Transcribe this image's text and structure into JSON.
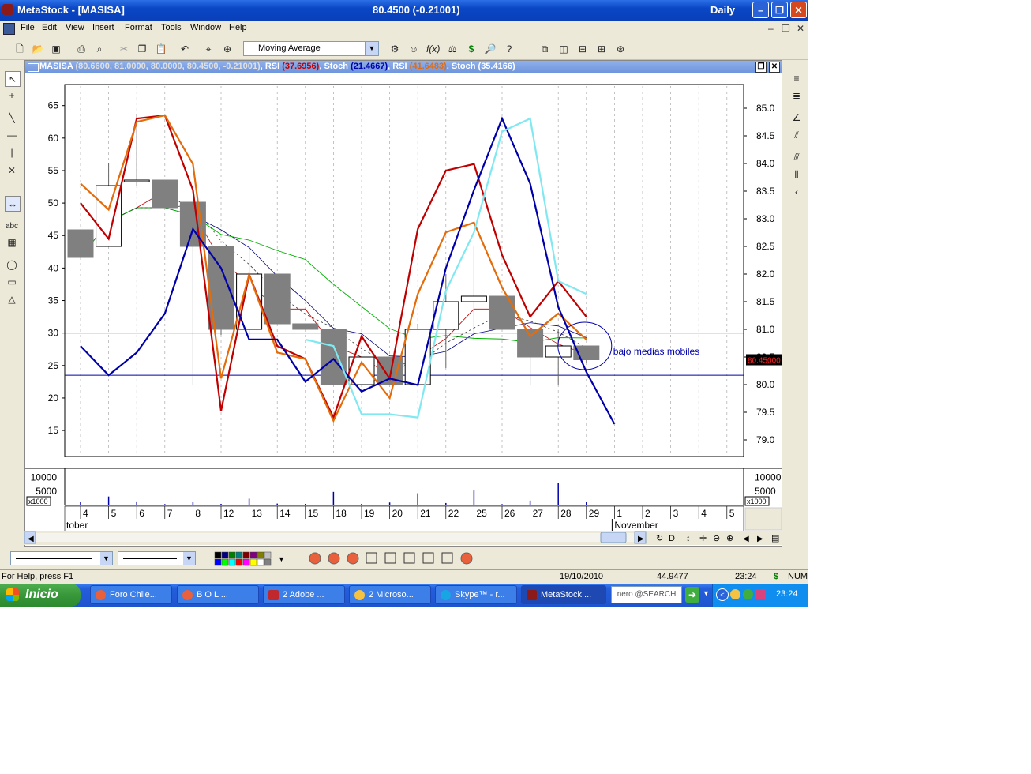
{
  "window": {
    "app_title": "MetaStock - [MASISA]",
    "quote": "80.4500 (-0.21001)",
    "period": "Daily"
  },
  "menu": [
    "File",
    "Edit",
    "View",
    "Insert",
    "Format",
    "Tools",
    "Window",
    "Help"
  ],
  "toolbar": {
    "indicator_select": "Moving Average"
  },
  "chart": {
    "title": {
      "name": "MASISA",
      "ohlc": "(80.6600, 81.0000, 80.0000, 80.4500, -0.21001)",
      "ind1": "RSI",
      "ind1_val": "(37.6956)",
      "ind2": "Stoch",
      "ind2_val": "(21.4667)",
      "ind3": "RSI",
      "ind3_val": "(41.6483)",
      "ind4": "Stoch",
      "ind4_val": "(35.4166)",
      "sep": ","
    },
    "left_axis": [
      "65",
      "60",
      "55",
      "50",
      "45",
      "40",
      "35",
      "30",
      "25",
      "20",
      "15"
    ],
    "right_axis": [
      "85.0",
      "84.5",
      "84.0",
      "83.5",
      "83.0",
      "82.5",
      "82.0",
      "81.5",
      "81.0",
      "80.5",
      "80.0",
      "79.5",
      "79.0"
    ],
    "price_label": "80.45000",
    "annotation": "bajo medias mobiles",
    "volume_axis": [
      "10000",
      "5000"
    ],
    "volume_unit": "x1000",
    "dates": [
      "4",
      "5",
      "6",
      "7",
      "8",
      "12",
      "13",
      "14",
      "15",
      "18",
      "19",
      "20",
      "21",
      "22",
      "25",
      "26",
      "27",
      "28",
      "29",
      "1",
      "2",
      "3",
      "4",
      "5"
    ],
    "month_left": "tober",
    "month_right": "November",
    "chart_data": {
      "type": "candlestick",
      "x": [
        "4",
        "5",
        "6",
        "7",
        "8",
        "12",
        "13",
        "14",
        "15",
        "18",
        "19",
        "20",
        "21",
        "22",
        "25",
        "26",
        "27",
        "28",
        "29"
      ],
      "price_axis_range": [
        78.7,
        85.4
      ],
      "oscillator_axis_range": [
        11,
        68
      ],
      "candles": [
        {
          "o": 82.8,
          "h": 82.8,
          "l": 82.3,
          "c": 82.3,
          "down": true
        },
        {
          "o": 82.5,
          "h": 84.0,
          "l": 82.5,
          "c": 83.6,
          "down": false
        },
        {
          "o": 83.7,
          "h": 84.9,
          "l": 83.6,
          "c": 83.7,
          "down": false
        },
        {
          "o": 83.7,
          "h": 83.7,
          "l": 83.2,
          "c": 83.2,
          "down": true
        },
        {
          "o": 83.3,
          "h": 83.3,
          "l": 80.0,
          "c": 82.5,
          "down": true
        },
        {
          "o": 82.5,
          "h": 82.5,
          "l": 80.9,
          "c": 81.0,
          "down": true
        },
        {
          "o": 81.0,
          "h": 82.5,
          "l": 80.9,
          "c": 82.0,
          "down": false
        },
        {
          "o": 82.0,
          "h": 82.0,
          "l": 81.1,
          "c": 81.1,
          "down": true
        },
        {
          "o": 81.1,
          "h": 81.1,
          "l": 81.0,
          "c": 81.0,
          "down": true
        },
        {
          "o": 81.0,
          "h": 81.0,
          "l": 80.0,
          "c": 80.0,
          "down": true
        },
        {
          "o": 80.0,
          "h": 80.5,
          "l": 80.0,
          "c": 80.5,
          "down": false
        },
        {
          "o": 80.5,
          "h": 80.5,
          "l": 80.0,
          "c": 80.0,
          "down": true
        },
        {
          "o": 80.0,
          "h": 81.1,
          "l": 80.0,
          "c": 81.0,
          "down": false
        },
        {
          "o": 81.0,
          "h": 82.0,
          "l": 80.3,
          "c": 81.5,
          "down": false
        },
        {
          "o": 81.5,
          "h": 82.5,
          "l": 80.8,
          "c": 81.6,
          "down": false
        },
        {
          "o": 81.6,
          "h": 81.6,
          "l": 81.0,
          "c": 81.0,
          "down": true
        },
        {
          "o": 81.0,
          "h": 81.0,
          "l": 80.0,
          "c": 80.5,
          "down": true
        },
        {
          "o": 80.5,
          "h": 81.0,
          "l": 80.0,
          "c": 80.7,
          "down": false
        },
        {
          "o": 80.7,
          "h": 80.7,
          "l": 80.4,
          "c": 80.45,
          "down": true
        }
      ],
      "horizontal_lines_osc": [
        70,
        30,
        23.5
      ],
      "series": [
        {
          "name": "RSI",
          "color": "#c00000",
          "values": [
            50,
            44.5,
            63,
            63.5,
            52,
            18,
            39,
            28,
            26,
            17,
            29.5,
            23,
            46,
            55,
            56,
            42,
            32.5,
            38,
            32.5
          ]
        },
        {
          "name": "RSI",
          "color": "#e46c0a",
          "values": [
            53,
            49,
            62.5,
            63.5,
            56,
            23,
            39,
            27,
            26,
            16.5,
            25.5,
            20,
            36,
            45.5,
            47,
            37,
            29.5,
            33,
            29
          ]
        },
        {
          "name": "Stoch",
          "color": "#0000aa",
          "values": [
            28,
            23.5,
            27,
            33,
            46,
            40,
            29,
            29,
            22.5,
            26,
            21,
            23,
            22,
            40,
            52,
            63,
            53,
            34,
            24,
            16
          ]
        },
        {
          "name": "Stoch",
          "color": "#80e8f0",
          "values": [
            null,
            null,
            null,
            null,
            null,
            null,
            34,
            null,
            29,
            28,
            17.5,
            17.5,
            17,
            36.5,
            45.5,
            61,
            63,
            38,
            36
          ]
        }
      ],
      "volume": [
        1000,
        3000,
        1200,
        200,
        900,
        300,
        2200,
        400,
        300,
        4700,
        300,
        800,
        4200,
        600,
        5200,
        200,
        1500,
        8000,
        1000
      ]
    }
  },
  "bottom": {
    "color_swatches": [
      "#000000",
      "#000080",
      "#008000",
      "#008080",
      "#800000",
      "#800080",
      "#808000",
      "#c0c0c0",
      "#0000ff",
      "#00ff00",
      "#00ffff",
      "#ff0000",
      "#ff00ff",
      "#ffff00",
      "#ffffff",
      "#808080"
    ]
  },
  "status": {
    "help": "For Help, press F1",
    "date": "19/10/2010",
    "value": "44.9477",
    "time": "23:24",
    "currency": "$",
    "num": "NUM"
  },
  "taskbar": {
    "start": "Inicio",
    "tasks": [
      "Foro Chile...",
      "B  O  L  ...",
      "2 Adobe ...",
      "2 Microso...",
      "Skype™ - r...",
      "MetaStock ..."
    ],
    "nero": "nero @SEARCH",
    "clock": "23:24"
  }
}
